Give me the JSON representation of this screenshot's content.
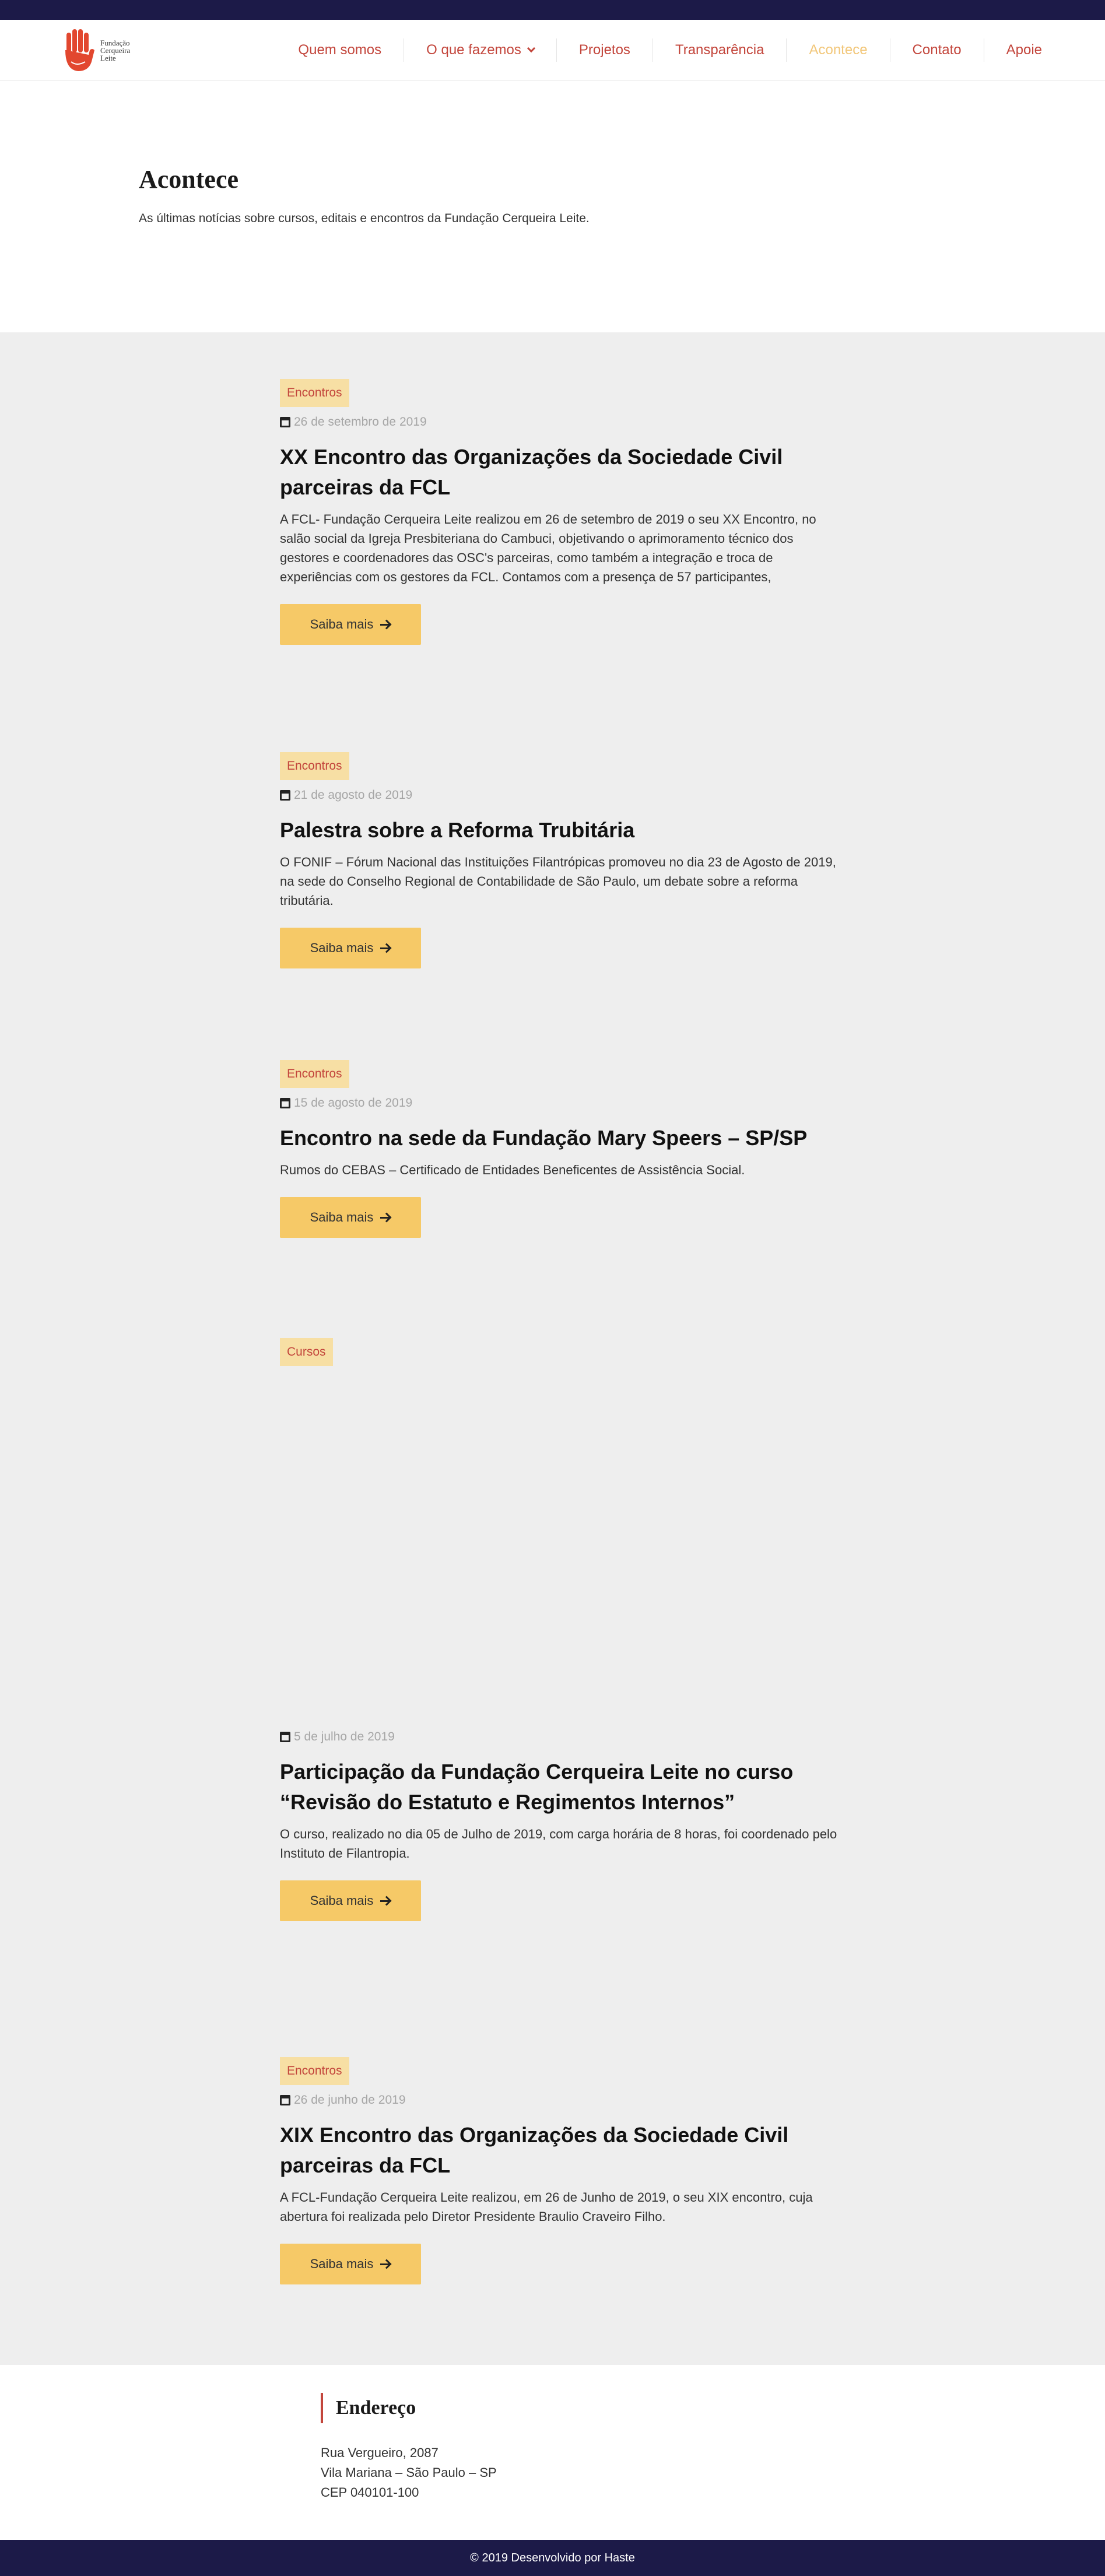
{
  "header": {
    "logo_text": [
      "Fundação",
      "Cerqueira",
      "Leite"
    ],
    "nav": [
      {
        "label": "Quem somos"
      },
      {
        "label": "O que fazemos"
      },
      {
        "label": "Projetos"
      },
      {
        "label": "Transparência"
      },
      {
        "label": "Acontece"
      },
      {
        "label": "Contato"
      },
      {
        "label": "Apoie"
      }
    ]
  },
  "colors": {
    "accent": "#c3463c",
    "navy": "#1c1a48",
    "button": "#f6c967",
    "active_nav": "#f2c77a"
  },
  "hero": {
    "title": "Acontece",
    "subtitle": "As últimas notícias sobre cursos, editais e encontros da Fundação Cerqueira Leite."
  },
  "posts": [
    {
      "tag": "Encontros",
      "date": "26 de setembro de 2019",
      "title": "XX Encontro das Organizações da Sociedade Civil parceiras da FCL",
      "excerpt": "A FCL- Fundação Cerqueira Leite realizou em 26 de setembro de 2019 o seu XX Encontro, no salão social da Igreja Presbiteriana do Cambuci, objetivando o aprimoramento técnico dos gestores e coordenadores das OSC's parceiras, como também a integração e troca de experiências com os gestores da FCL. Contamos com a presença de 57 participantes,",
      "button": "Saiba mais"
    },
    {
      "tag": "Encontros",
      "date": "21 de agosto de 2019",
      "title": "Palestra sobre a Reforma Trubitária",
      "excerpt": "O FONIF – Fórum Nacional das Instituições Filantrópicas promoveu no dia 23 de Agosto de 2019, na sede do Conselho Regional de Contabilidade de São Paulo, um debate sobre a reforma tributária.",
      "button": "Saiba mais"
    },
    {
      "tag": "Encontros",
      "date": "15 de agosto de 2019",
      "title": "Encontro na sede da Fundação Mary Speers – SP/SP",
      "excerpt": "Rumos do CEBAS – Certificado de Entidades Beneficentes de Assistência Social.",
      "button": "Saiba mais"
    },
    {
      "tag": "Cursos",
      "date": "5 de julho de 2019",
      "title": "Participação da Fundação Cerqueira Leite no curso “Revisão do Estatuto e Regimentos Internos”",
      "excerpt": "O curso, realizado no dia 05 de Julho de 2019, com carga horária de 8 horas, foi coordenado pelo Instituto de Filantropia.",
      "button": "Saiba mais"
    },
    {
      "tag": "Encontros",
      "date": "26 de junho de 2019",
      "title": "XIX Encontro das Organizações da Sociedade Civil parceiras da FCL",
      "excerpt": "A FCL-Fundação Cerqueira Leite realizou, em 26 de Junho de 2019, o seu XIX encontro, cuja abertura foi realizada pelo Diretor Presidente Braulio Craveiro Filho.",
      "button": "Saiba mais"
    }
  ],
  "footer": {
    "address_title": "Endereço",
    "address_lines": [
      "Rua Vergueiro, 2087",
      "Vila Mariana – São Paulo – SP",
      "CEP 040101-100"
    ],
    "copyright": "© 2019 Desenvolvido por Haste"
  }
}
